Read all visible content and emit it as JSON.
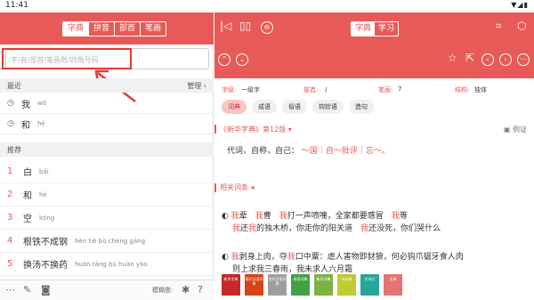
{
  "status": {
    "time": "11:41",
    "icons": "▼◢▮"
  },
  "left": {
    "tabs": [
      "字典",
      "拼音",
      "部首",
      "笔画"
    ],
    "search_placeholder": "字/音/部首/笔画数/四角号码",
    "recent_label": "最近",
    "manage_label": "管理 ›",
    "recent": [
      {
        "char": "我",
        "pinyin": "wǒ"
      },
      {
        "char": "和",
        "pinyin": "hé"
      }
    ],
    "recommend_label": "推荐",
    "recommend": [
      {
        "num": "1",
        "word": "白",
        "pinyin": "bái"
      },
      {
        "num": "2",
        "word": "和",
        "pinyin": "hé"
      },
      {
        "num": "3",
        "word": "空",
        "pinyin": "kōng"
      },
      {
        "num": "4",
        "word": "根铁不成钢",
        "pinyin": "hèn tiě bù chéng gāng"
      },
      {
        "num": "5",
        "word": "换汤不换药",
        "pinyin": "huàn tāng bù huàn yào"
      }
    ],
    "footer_mode": "模糊查:"
  },
  "right": {
    "tabs": [
      "字典",
      "学习"
    ],
    "info": {
      "level_k": "字级:",
      "level_v": "一级字",
      "radical_k": "部首:",
      "radical_v": "丿",
      "strokes_k": "笔画:",
      "strokes_v": "7",
      "structure_k": "结构:",
      "structure_v": "独体"
    },
    "pills": [
      "词典",
      "成语",
      "俗语",
      "钩妙语",
      "造句"
    ],
    "dict_title": "《新华字典》第12版 ▾",
    "example_label": "例证",
    "def_text": "代词，自称，自己：",
    "def_examples": "～国｜自～批评｜忘～。",
    "related_label": "相关词条 ◂",
    "para1_l1a": "我",
    "para1_l1b": "辈　",
    "para1_l1c": "我",
    "para1_l1d": "曹　",
    "para1_l1e": "我",
    "para1_l1f": "打一声喷嚏，全家都要感冒　",
    "para1_l1g": "我",
    "para1_l1h": "等",
    "para1_l2a": "我",
    "para1_l2b": "还",
    "para1_l2c": "我",
    "para1_l2d": "的独木桥，你走你的阳关道　",
    "para1_l2e": "我",
    "para1_l2f": "还没死，你们哭什么",
    "para2_l1a": "我",
    "para2_l1b": "剥",
    "para2_l1c": "身上肉，夺",
    "para2_l1d": "我",
    "para2_l1e": "口中粟：虐人害物即豺狼，何必钩爪锯牙食人肉",
    "para2_l2": "则上求我三春雨，我未求人六月霜",
    "books": [
      "新华字典",
      "现代汉语词典",
      "古代汉语词典",
      "成语词典",
      "新华词典",
      "诗词典",
      "古诗文",
      "字典"
    ]
  },
  "colors": {
    "accent": "#e85a58"
  }
}
